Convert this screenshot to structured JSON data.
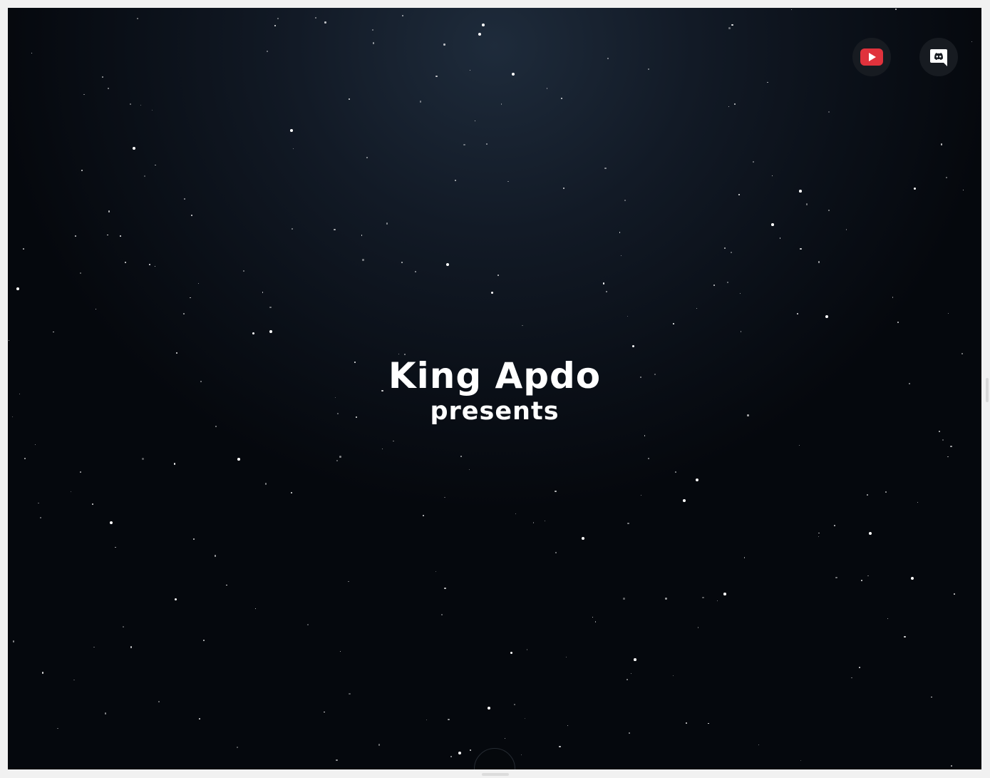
{
  "hero": {
    "title": "King Apdo",
    "subtitle": "presents"
  },
  "social": {
    "youtube_icon": "youtube-icon",
    "discord_icon": "discord-icon",
    "youtube_color": "#e0323c",
    "discord_color": "#ffffff"
  },
  "colors": {
    "background_center": "#1e2b3b",
    "background_edge": "#05080d",
    "text": "#ffffff"
  }
}
